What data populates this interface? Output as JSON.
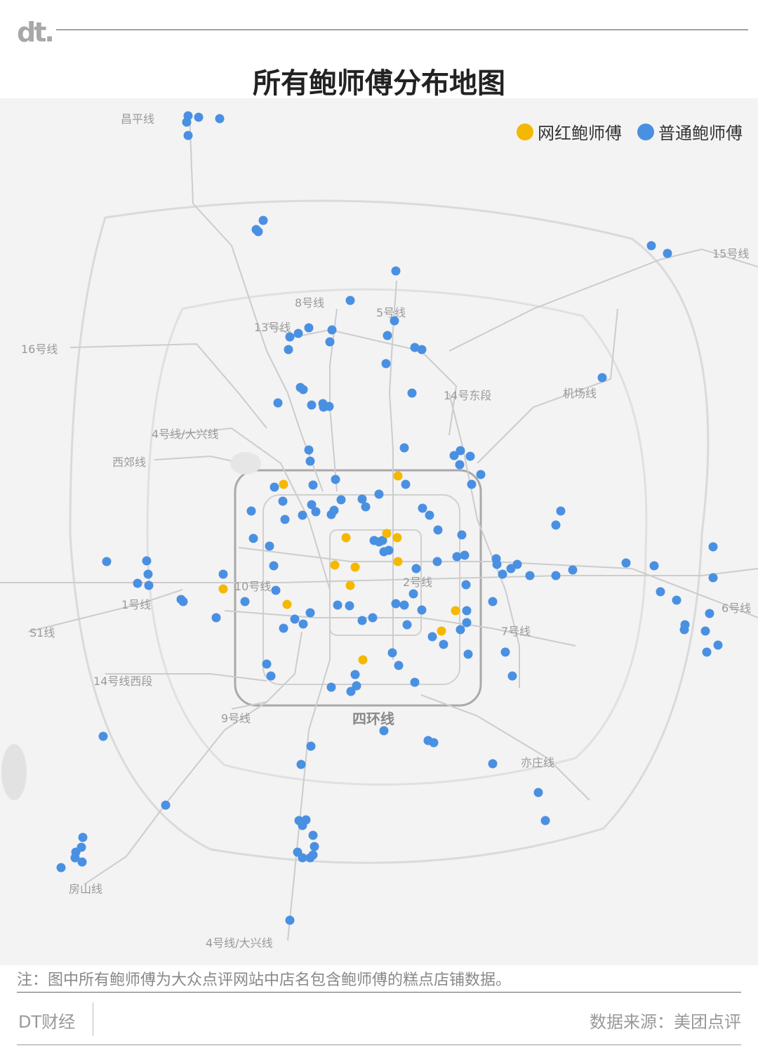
{
  "header": {
    "logo": "dt.",
    "title": "所有鲍师傅分布地图"
  },
  "legend": {
    "items": [
      {
        "label": "网红鲍师傅",
        "color": "#F5B800"
      },
      {
        "label": "普通鲍师傅",
        "color": "#4A90E2"
      }
    ]
  },
  "map": {
    "ring_label": "四环线",
    "line_labels": {
      "changping": "昌平线",
      "line15": "15号线",
      "line8": "8号线",
      "line5": "5号线",
      "line13": "13号线",
      "line16": "16号线",
      "line14e": "14号东段",
      "airport": "机场线",
      "line4": "4号线/大兴线",
      "xijiao": "西郊线",
      "line10": "10号线",
      "line2": "2号线",
      "line1": "1号线",
      "line6": "6号线",
      "s1": "S1线",
      "line7": "7号线",
      "line14w": "14号线西段",
      "line9": "9号线",
      "yizhuang": "亦庄线",
      "fangshan": "房山线",
      "line4s": "4号线/大兴线"
    }
  },
  "footer": {
    "note": "注：图中所有鲍师傅为大众点评网站中店名包含鲍师傅的糕点店铺数据。",
    "brand": "DT财经",
    "source": "数据来源：美团点评"
  }
}
